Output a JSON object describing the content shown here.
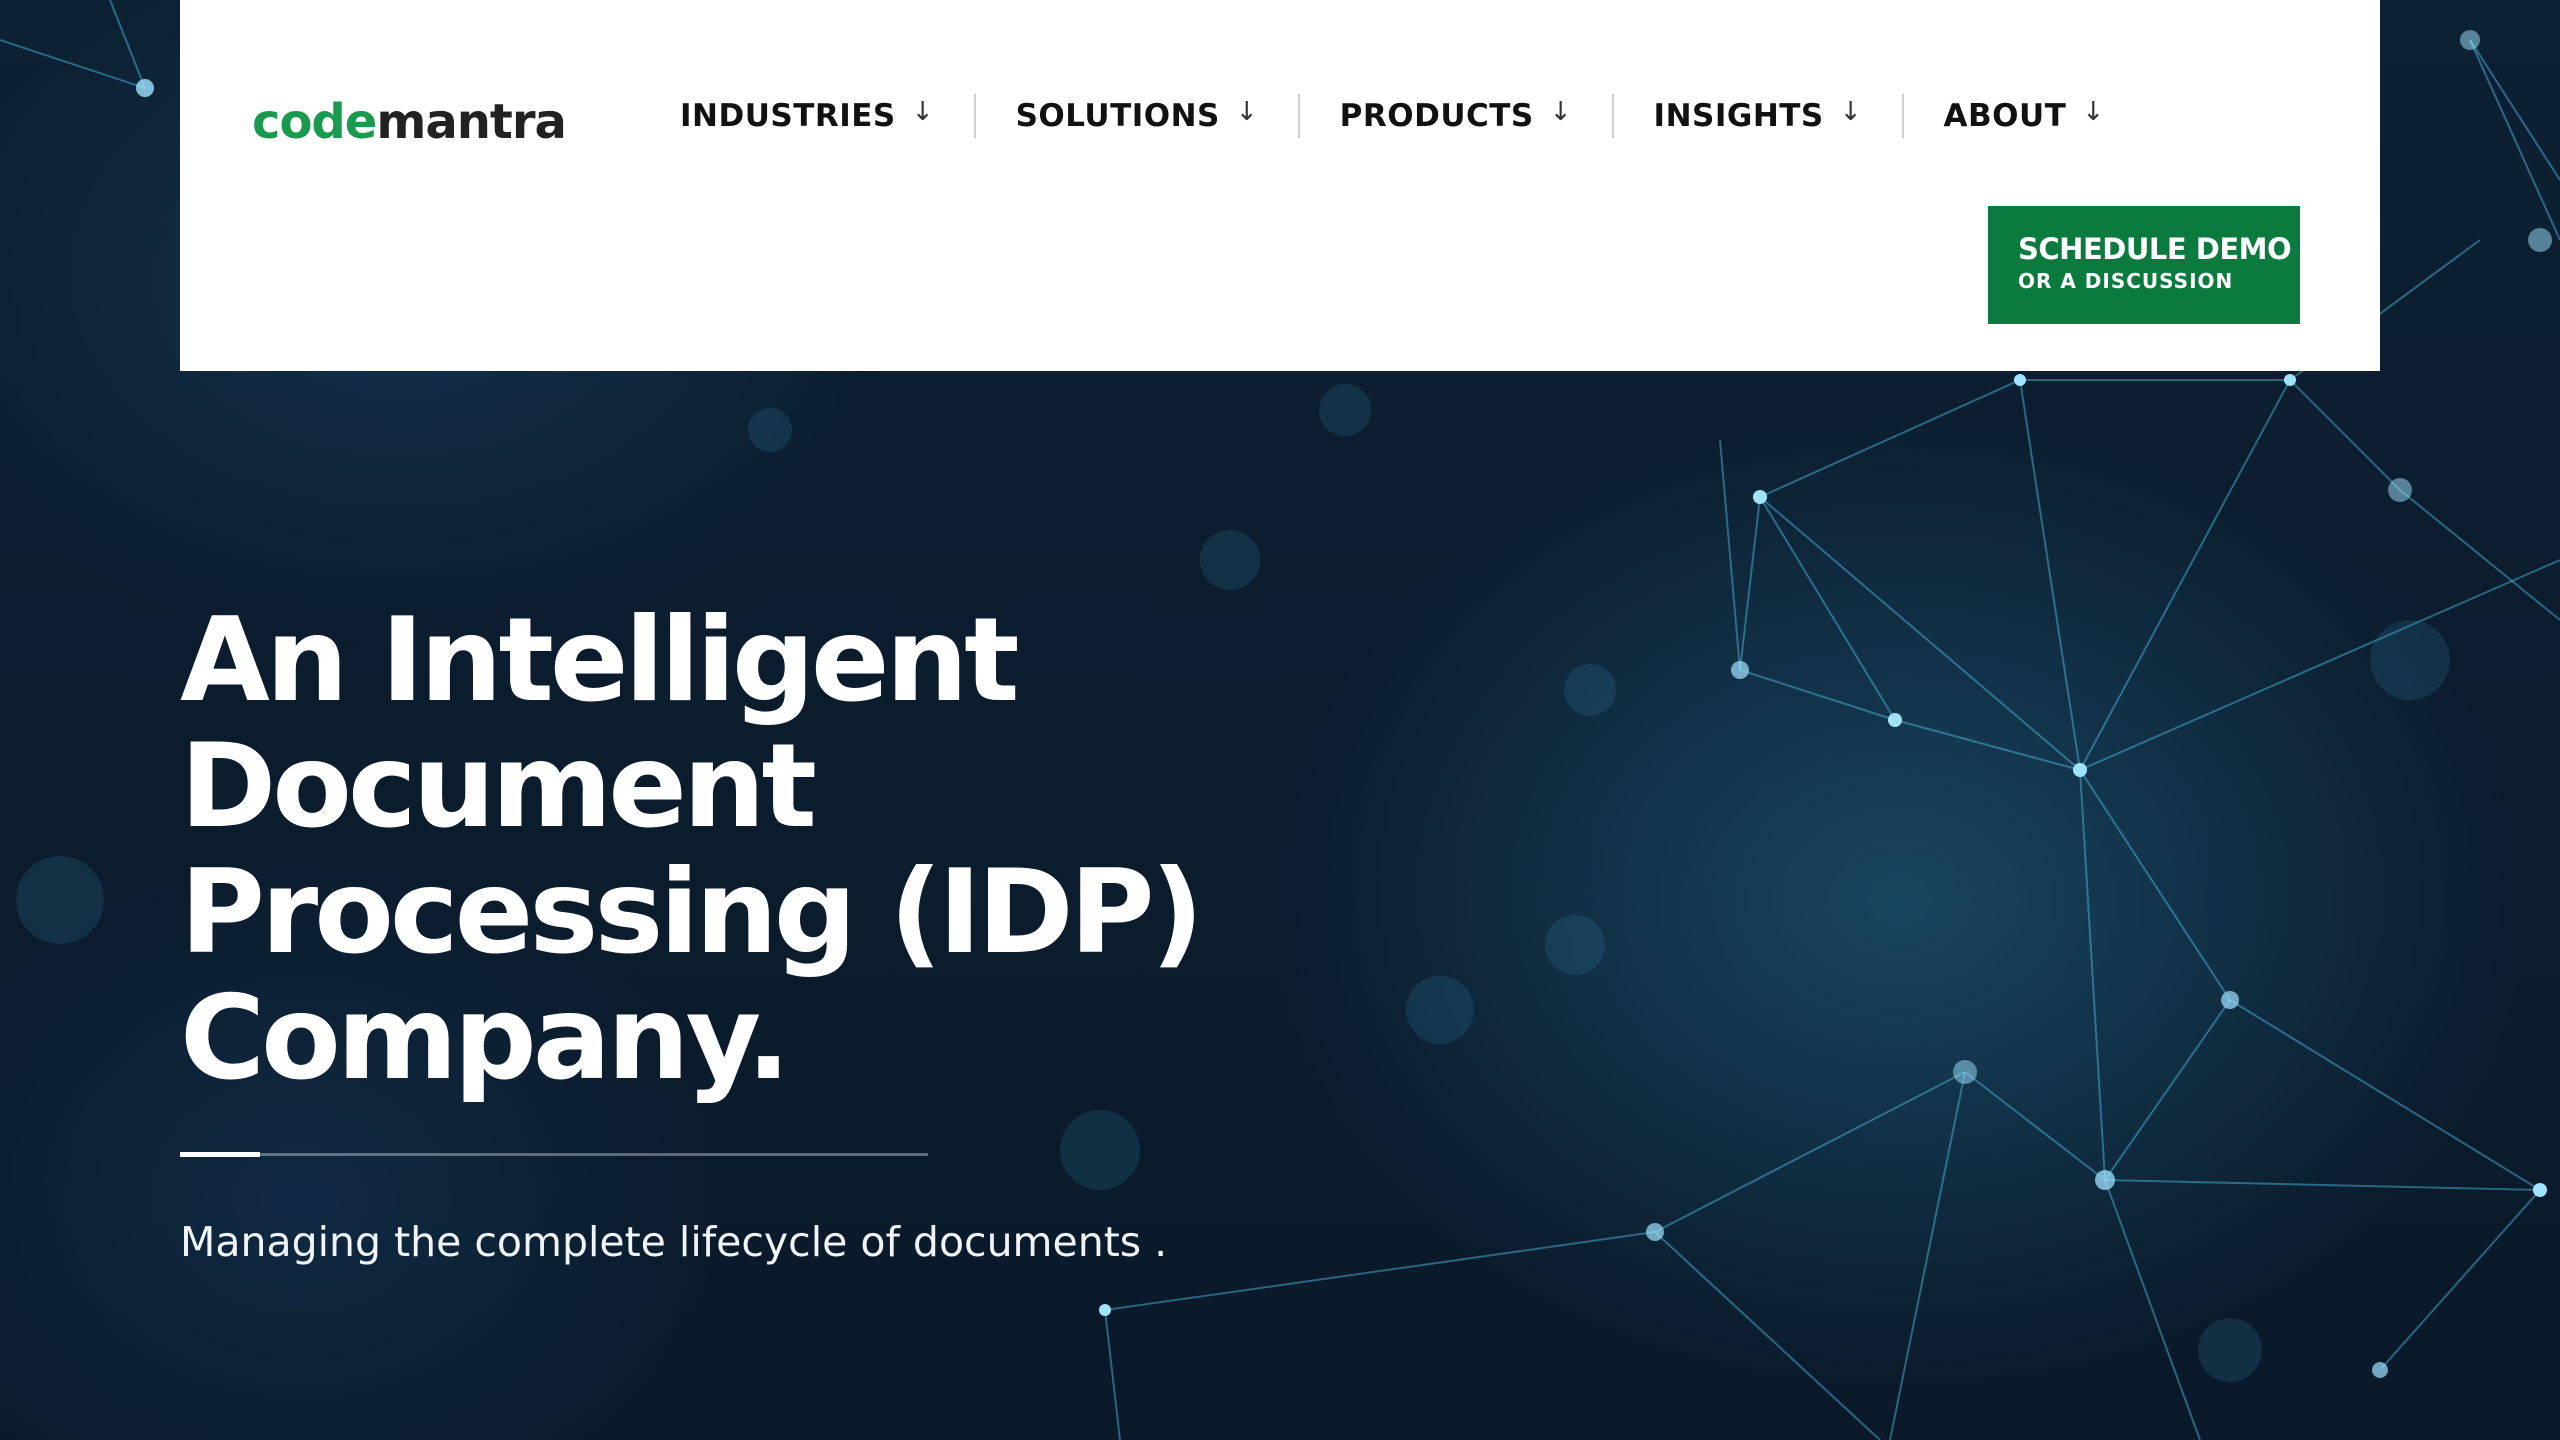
{
  "brand": {
    "logo_part1": "code",
    "logo_part2": "mantra",
    "logo_color_primary": "#1a9a4f",
    "logo_color_secondary": "#222222"
  },
  "nav": {
    "items": [
      {
        "label": "INDUSTRIES",
        "icon": "arrow-down-icon"
      },
      {
        "label": "SOLUTIONS",
        "icon": "arrow-down-icon"
      },
      {
        "label": "PRODUCTS",
        "icon": "arrow-down-icon"
      },
      {
        "label": "INSIGHTS",
        "icon": "arrow-down-icon"
      },
      {
        "label": "ABOUT",
        "icon": "arrow-down-icon"
      }
    ],
    "arrow_glyph": "↓"
  },
  "cta": {
    "line1": "SCHEDULE DEMO",
    "line2": "OR A DISCUSSION",
    "color": "#0b7a3e"
  },
  "hero": {
    "title_lines": [
      "An Intelligent",
      "Document",
      "Processing (IDP)",
      "Company."
    ],
    "tagline": "Managing the complete lifecycle of documents ."
  },
  "colors": {
    "background": "#0a1a2a",
    "network": "#4fc3e6",
    "header_bg": "#ffffff"
  }
}
